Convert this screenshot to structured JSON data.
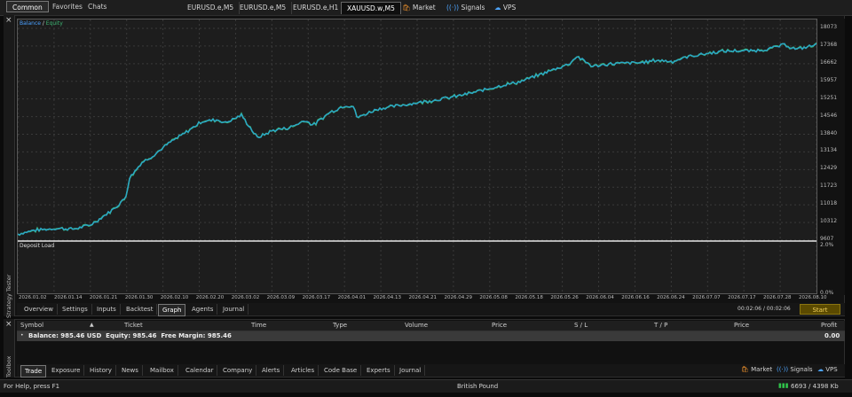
{
  "top_tabs": [
    "Common",
    "Favorites",
    "Chats"
  ],
  "chart_tabs": [
    "EURUSD.e,M5",
    "EURUSD.e,M5",
    "EURUSD.e,H1",
    "XAUUSD.w,M5"
  ],
  "top_links": {
    "market": "Market",
    "signals": "Signals",
    "vps": "VPS"
  },
  "tester": {
    "legend_balance": "Balance",
    "legend_sep": " / ",
    "legend_equity": "Equity",
    "deposit_load_label": "Deposit Load",
    "side_label": "Strategy Tester",
    "close_glyph": "×",
    "y_ticks": [
      "18073",
      "17368",
      "16662",
      "15957",
      "15251",
      "14546",
      "13840",
      "13134",
      "12429",
      "11723",
      "11018",
      "10312",
      "9607"
    ],
    "load_ticks": [
      "2.0%",
      "0.0%"
    ],
    "x_ticks": [
      "2026.01.02",
      "2026.01.14",
      "2026.01.21",
      "2026.01.30",
      "2026.02.10",
      "2026.02.20",
      "2026.03.02",
      "2026.03.09",
      "2026.03.17",
      "2026.04.01",
      "2026.04.13",
      "2026.04.21",
      "2026.04.29",
      "2026.05.08",
      "2026.05.18",
      "2026.05.26",
      "2026.06.04",
      "2026.06.16",
      "2026.06.24",
      "2026.07.07",
      "2026.07.17",
      "2026.07.28",
      "2026.08.10"
    ],
    "tabs": [
      "Overview",
      "Settings",
      "Inputs",
      "Backtest",
      "Graph",
      "Agents",
      "Journal"
    ],
    "active_tab": "Graph",
    "elapsed": "00:02:06 / 00:02:06",
    "start_label": "Start"
  },
  "chart_data": {
    "type": "line",
    "ylim": [
      9607,
      18073
    ],
    "series": [
      {
        "name": "Balance",
        "color": "#1e90ff"
      },
      {
        "name": "Equity",
        "color": "#3cb371"
      }
    ],
    "points": [
      [
        0,
        9850
      ],
      [
        0.02,
        10000
      ],
      [
        0.05,
        10080
      ],
      [
        0.07,
        10050
      ],
      [
        0.09,
        10200
      ],
      [
        0.1,
        10400
      ],
      [
        0.12,
        10850
      ],
      [
        0.135,
        11300
      ],
      [
        0.14,
        12100
      ],
      [
        0.155,
        12700
      ],
      [
        0.17,
        13000
      ],
      [
        0.19,
        13500
      ],
      [
        0.21,
        13900
      ],
      [
        0.23,
        14350
      ],
      [
        0.25,
        14420
      ],
      [
        0.26,
        14300
      ],
      [
        0.28,
        14600
      ],
      [
        0.29,
        14150
      ],
      [
        0.3,
        13700
      ],
      [
        0.32,
        14000
      ],
      [
        0.34,
        14100
      ],
      [
        0.36,
        14400
      ],
      [
        0.37,
        14200
      ],
      [
        0.39,
        14700
      ],
      [
        0.41,
        15000
      ],
      [
        0.42,
        14950
      ],
      [
        0.425,
        14500
      ],
      [
        0.45,
        14850
      ],
      [
        0.48,
        15000
      ],
      [
        0.51,
        15150
      ],
      [
        0.54,
        15300
      ],
      [
        0.57,
        15500
      ],
      [
        0.6,
        15750
      ],
      [
        0.63,
        15950
      ],
      [
        0.66,
        16300
      ],
      [
        0.69,
        16650
      ],
      [
        0.7,
        16950
      ],
      [
        0.72,
        16550
      ],
      [
        0.74,
        16650
      ],
      [
        0.76,
        16680
      ],
      [
        0.78,
        16700
      ],
      [
        0.8,
        16800
      ],
      [
        0.82,
        16750
      ],
      [
        0.84,
        16950
      ],
      [
        0.86,
        17050
      ],
      [
        0.88,
        17150
      ],
      [
        0.9,
        17180
      ],
      [
        0.92,
        17170
      ],
      [
        0.94,
        17250
      ],
      [
        0.96,
        17420
      ],
      [
        0.975,
        17230
      ],
      [
        1.0,
        17420
      ]
    ]
  },
  "toolbox": {
    "columns": [
      "Symbol",
      "Ticket",
      "Time",
      "Type",
      "Volume",
      "Price",
      "S / L",
      "T / P",
      "Price",
      "Profit"
    ],
    "balance_line": "Balance: 985.46 USD  Equity: 985.46  Free Margin: 985.46",
    "profit_total": "0.00",
    "side_label": "Toolbox",
    "tabs": [
      "Trade",
      "Exposure",
      "History",
      "News",
      "Mailbox",
      "Calendar",
      "Company",
      "Alerts",
      "Articles",
      "Code Base",
      "Experts",
      "Journal"
    ],
    "active_tab": "Trade",
    "market": "Market",
    "signals": "Signals",
    "vps": "VPS"
  },
  "status": {
    "help": "For Help, press F1",
    "profile": "British Pound",
    "traffic": "6693 / 4398 Kb"
  }
}
